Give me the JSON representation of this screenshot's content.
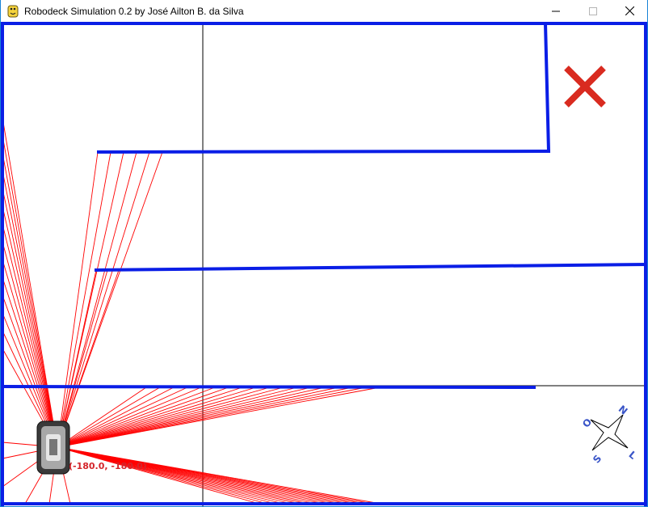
{
  "window": {
    "title": "Robodeck Simulation 0.2 by José Ailton B. da Silva",
    "app_icon": "python-snake-icon",
    "buttons": {
      "minimize": "minimize-icon",
      "maximize": "maximize-icon",
      "close": "close-icon"
    }
  },
  "simulation": {
    "robot_coordinates": "(-180.0, -180.0)",
    "goal_marker": "x-goal-icon",
    "compass": {
      "north": "N",
      "east": "L",
      "south": "S",
      "west": "O"
    },
    "colors": {
      "walls": "#0a1ee6",
      "sensor_rays": "#ff0000",
      "goal": "#d92b20",
      "axes": "#000000",
      "compass_text": "#3a55c8"
    }
  }
}
